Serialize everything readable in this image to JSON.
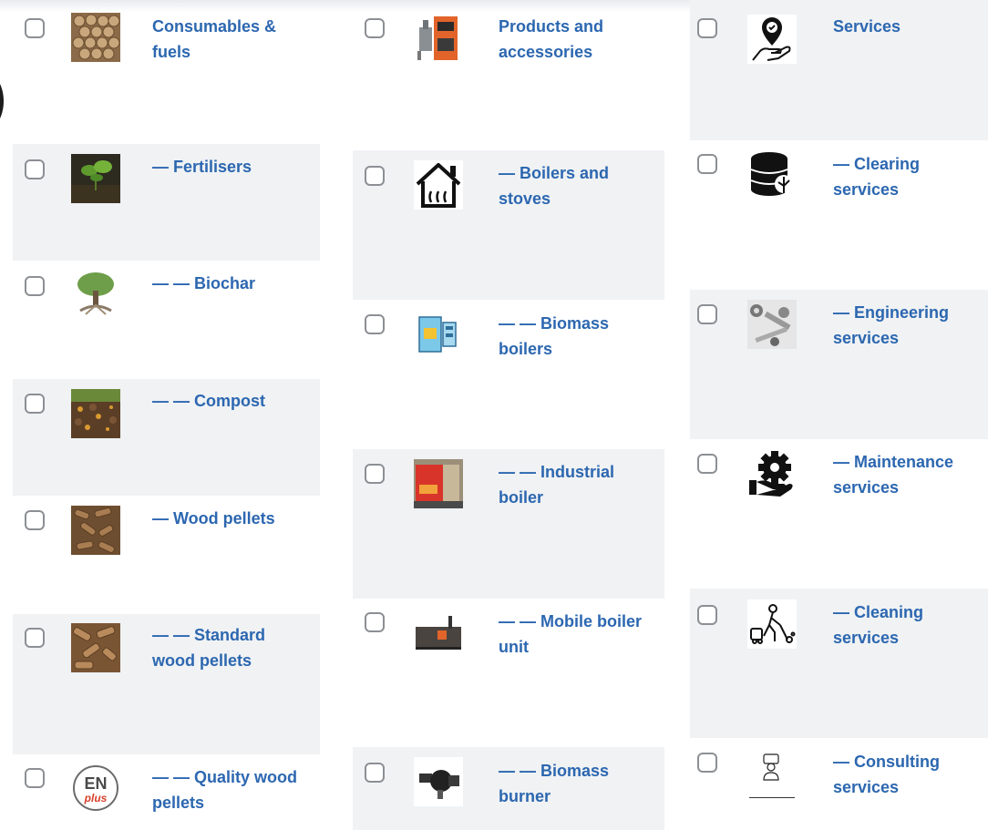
{
  "columns": [
    {
      "items": [
        {
          "label": "Consumables & fuels",
          "icon": "firewood-logs-icon"
        },
        {
          "label": "— Fertilisers",
          "icon": "plant-sprout-icon"
        },
        {
          "label": "— — Biochar",
          "icon": "biochar-tree-icon"
        },
        {
          "label": "— — Compost",
          "icon": "compost-soil-icon"
        },
        {
          "label": "— Wood pellets",
          "icon": "wood-pellets-icon"
        },
        {
          "label": "— — Standard wood pellets",
          "icon": "wood-pellets-icon"
        },
        {
          "label": "— — Quality wood pellets",
          "icon": "enplus-logo-icon"
        }
      ]
    },
    {
      "items": [
        {
          "label": "Products and accessories",
          "icon": "boiler-unit-icon"
        },
        {
          "label": "— Boilers and stoves",
          "icon": "house-heating-icon"
        },
        {
          "label": "— — Biomass boilers",
          "icon": "biomass-boiler-icon"
        },
        {
          "label": "— — Industrial boiler",
          "icon": "industrial-boiler-icon"
        },
        {
          "label": "— — Mobile boiler unit",
          "icon": "mobile-boiler-icon"
        },
        {
          "label": "— — Biomass burner",
          "icon": "burner-icon"
        }
      ]
    },
    {
      "items": [
        {
          "label": "Services",
          "icon": "hand-service-icon"
        },
        {
          "label": "— Clearing services",
          "icon": "clearing-database-icon"
        },
        {
          "label": "— Engineering services",
          "icon": "engineering-tools-icon"
        },
        {
          "label": "— Maintenance services",
          "icon": "gear-hand-icon"
        },
        {
          "label": "— Cleaning services",
          "icon": "cleaning-person-icon"
        },
        {
          "label": "— Consulting services",
          "icon": "consultant-icon"
        }
      ]
    }
  ],
  "colors": {
    "link": "#2c67b0",
    "alt_row": "#f0f2f4",
    "checkbox_border": "#8c8f94"
  }
}
